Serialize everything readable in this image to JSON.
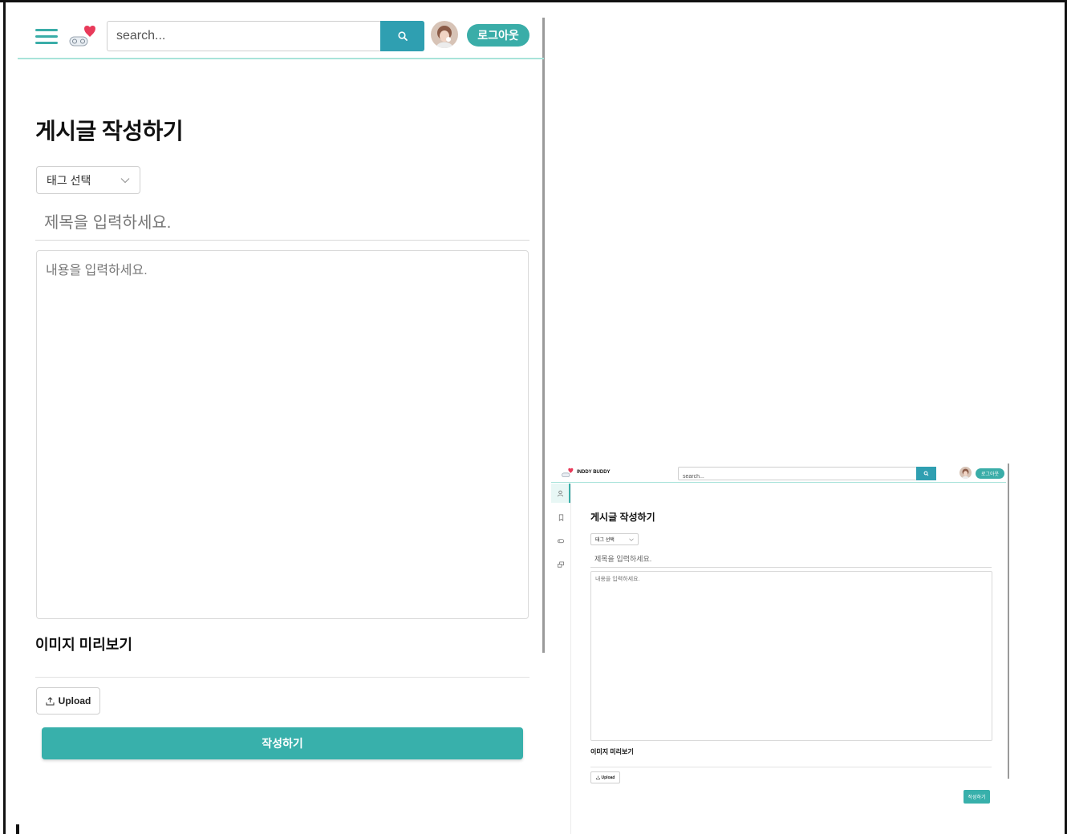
{
  "colors": {
    "accent": "#3aada8",
    "search_button": "#2f9fb1",
    "header_border": "#a9e3da",
    "heart": "#e83a5a"
  },
  "mobile": {
    "search": {
      "placeholder": "search..."
    },
    "logout_label": "로그아웃",
    "page_title": "게시글 작성하기",
    "tag_select": {
      "selected": "태그 선택"
    },
    "title_input": {
      "placeholder": "제목을 입력하세요."
    },
    "content_input": {
      "placeholder": "내용을 입력하세요."
    },
    "preview_heading": "이미지 미리보기",
    "upload_label": "Upload",
    "submit_label": "작성하기"
  },
  "desktop": {
    "brand": "INDDY BUDDY",
    "search": {
      "placeholder": "search..."
    },
    "logout_label": "로그아웃",
    "sidebar": [
      {
        "icon": "user-icon",
        "active": true
      },
      {
        "icon": "bookmark-icon",
        "active": false
      },
      {
        "icon": "gamepad-icon",
        "active": false
      },
      {
        "icon": "chat-icon",
        "active": false
      }
    ],
    "page_title": "게시글 작성하기",
    "tag_select": {
      "selected": "태그 선택"
    },
    "title_input": {
      "placeholder": "제목을 입력하세요."
    },
    "content_input": {
      "placeholder": "내용을 입력하세요."
    },
    "preview_heading": "이미지 미리보기",
    "upload_label": "Upload",
    "submit_label": "작성하기"
  }
}
